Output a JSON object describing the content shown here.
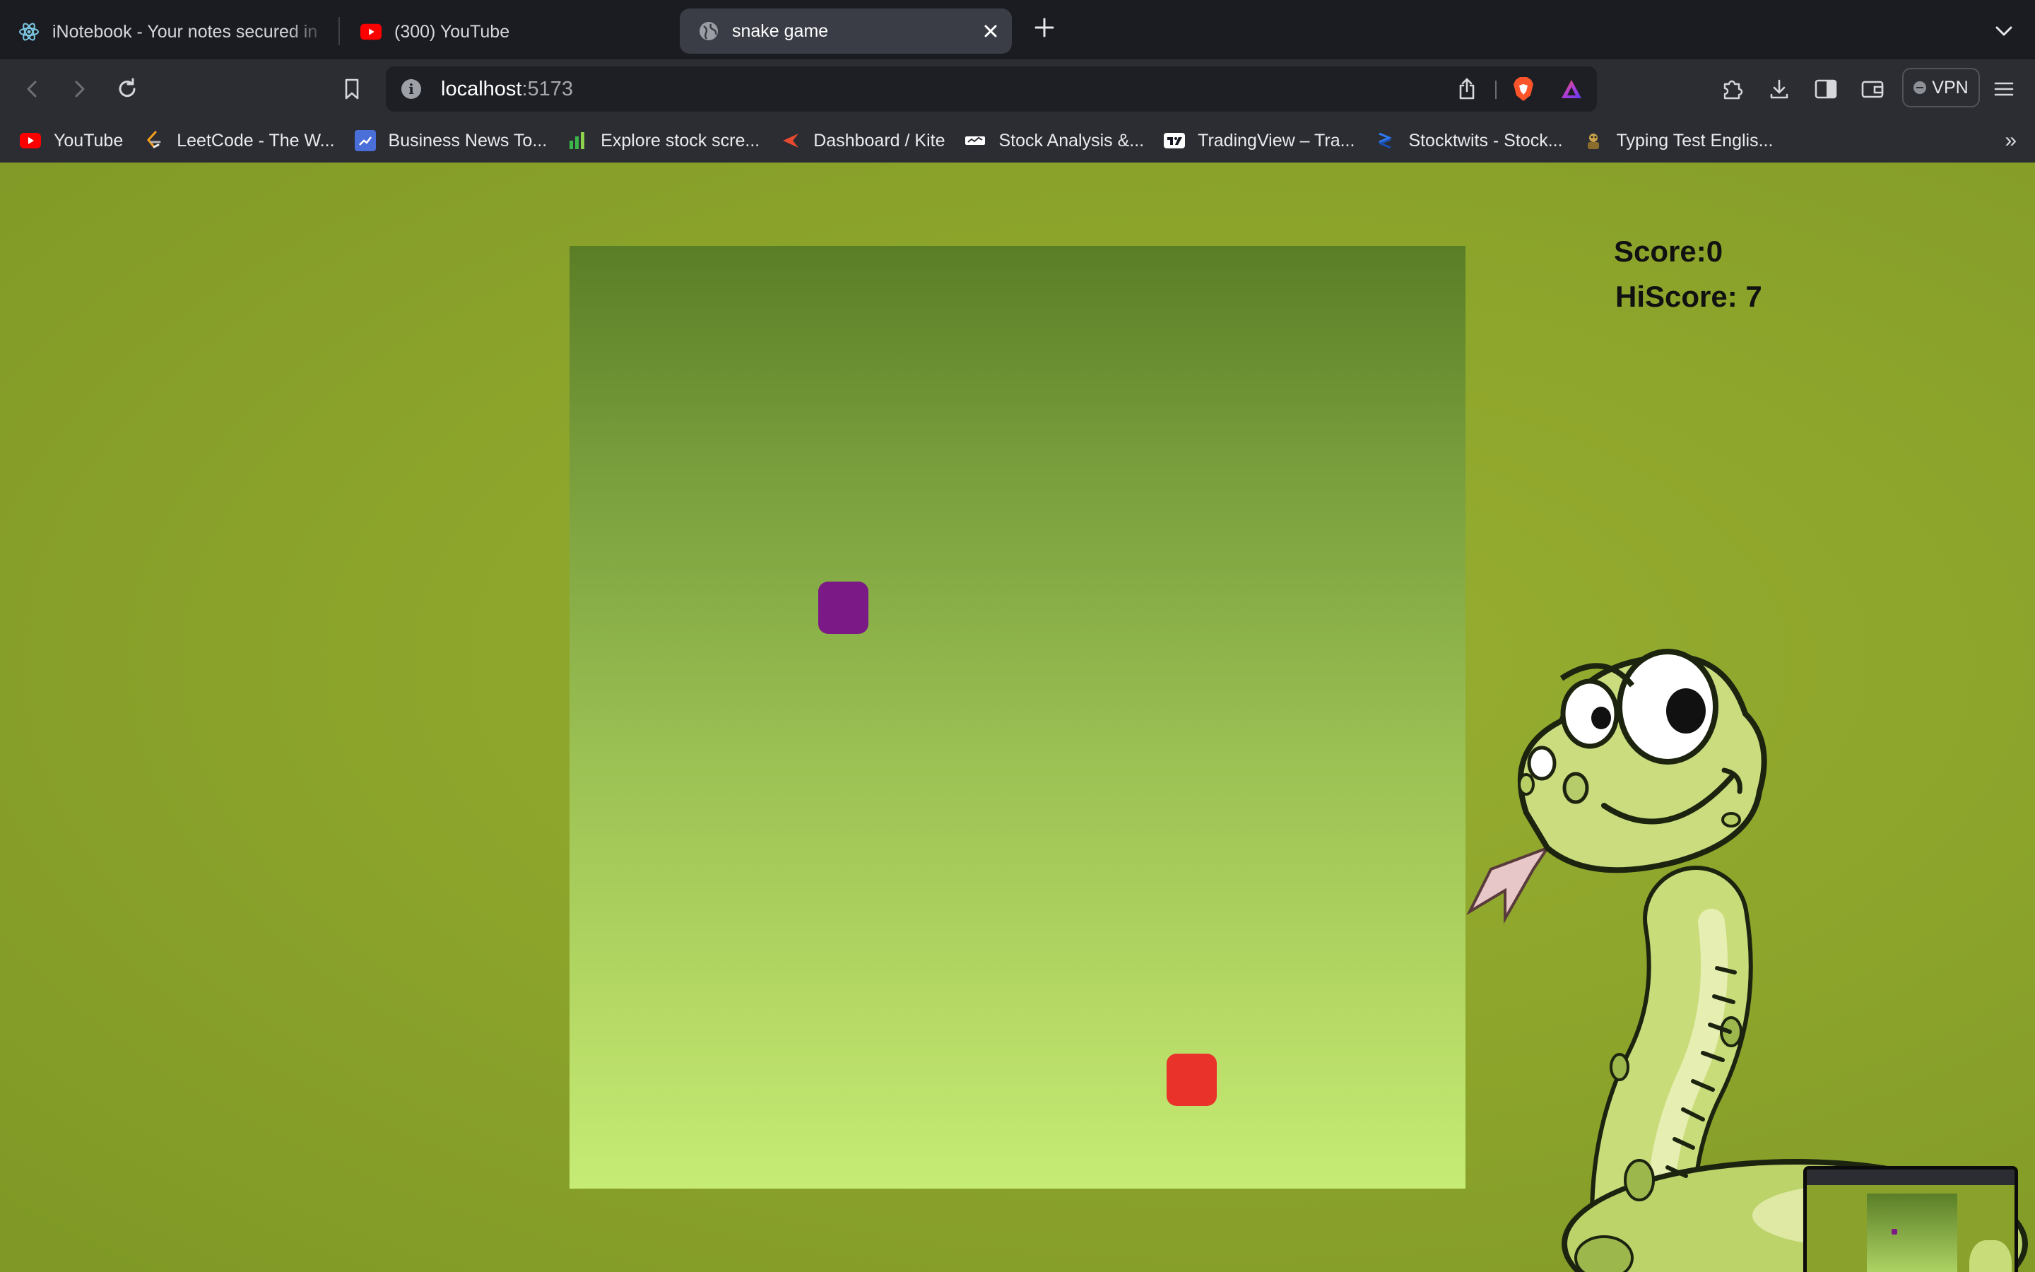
{
  "tabs": [
    {
      "title": "iNotebook - Your notes secured in",
      "icon": "react-icon"
    },
    {
      "title": "(300) YouTube",
      "icon": "youtube-icon"
    },
    {
      "title": "snake game",
      "icon": "globe-icon",
      "active": true
    }
  ],
  "address": {
    "host": "localhost",
    "port": ":5173"
  },
  "toolbar": {
    "vpn_label": "VPN"
  },
  "bookmarks": [
    {
      "label": "YouTube",
      "icon": "youtube-icon",
      "color": "#ff0000"
    },
    {
      "label": "LeetCode - The W...",
      "icon": "leetcode-icon",
      "color": "#f89f1b"
    },
    {
      "label": "Business News To...",
      "icon": "business-news-icon",
      "color": "#4a6fd8"
    },
    {
      "label": "Explore stock scre...",
      "icon": "bar-chart-icon",
      "color": "#3bb54a"
    },
    {
      "label": "Dashboard / Kite",
      "icon": "kite-icon",
      "color": "#e84a2f"
    },
    {
      "label": "Stock Analysis &...",
      "icon": "stock-analysis-icon",
      "color": "#ffffff"
    },
    {
      "label": "TradingView – Tra...",
      "icon": "tradingview-icon",
      "color": "#ffffff"
    },
    {
      "label": "Stocktwits - Stock...",
      "icon": "stocktwits-icon",
      "color": "#2f7bf5"
    },
    {
      "label": "Typing Test Englis...",
      "icon": "typing-test-icon",
      "color": "#c9a24a"
    }
  ],
  "game": {
    "score": "Score:0",
    "hiscore": "HiScore: 7",
    "snake_color": "#7b1a86",
    "food_color": "#e8322a"
  }
}
